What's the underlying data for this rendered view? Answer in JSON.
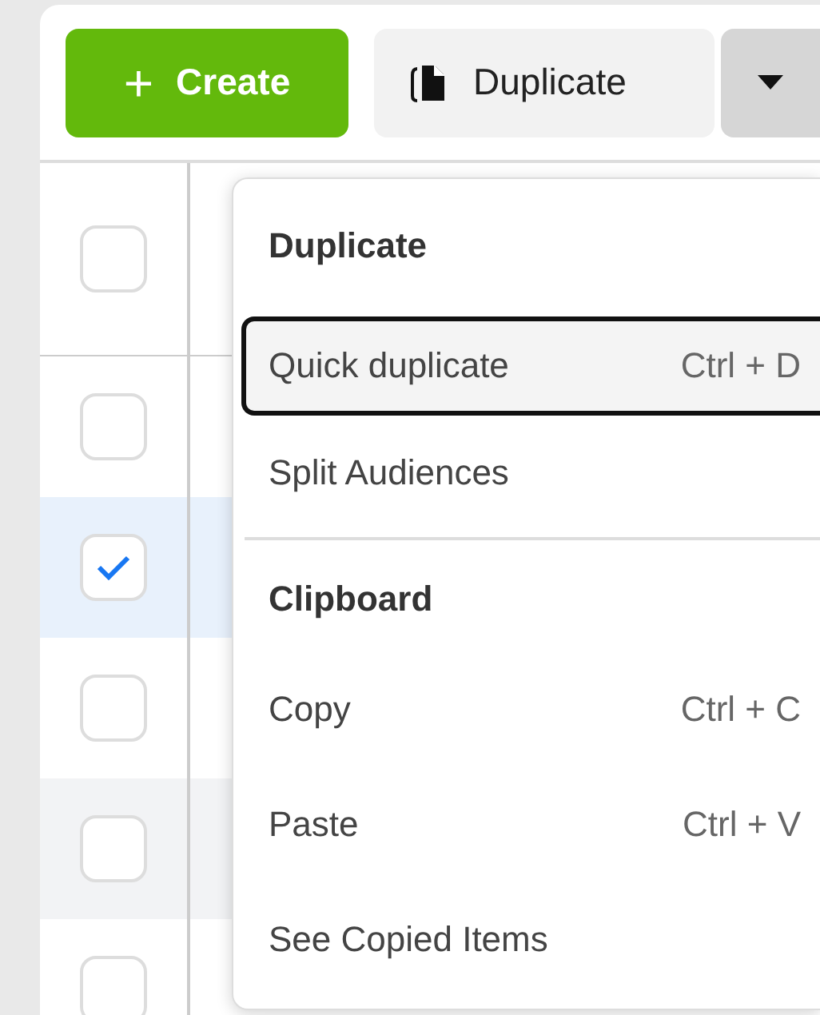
{
  "toolbar": {
    "create_button": {
      "icon": "+",
      "label": "Create"
    },
    "duplicate_button": {
      "label": "Duplicate"
    },
    "more_button": {
      "expanded": true
    }
  },
  "table": {
    "rows": [
      {
        "kind": "header",
        "checked": false
      },
      {
        "kind": "row",
        "checked": false,
        "selected": false,
        "hovered": false
      },
      {
        "kind": "row",
        "checked": true,
        "selected": true,
        "hovered": false
      },
      {
        "kind": "row",
        "checked": false,
        "selected": false,
        "hovered": false
      },
      {
        "kind": "row",
        "checked": false,
        "selected": false,
        "hovered": true
      },
      {
        "kind": "row",
        "checked": false,
        "selected": false,
        "hovered": false
      }
    ]
  },
  "menu": {
    "sections": [
      {
        "title": "Duplicate",
        "items": [
          {
            "label": "Quick duplicate",
            "shortcut": "Ctrl + D",
            "focused": true
          },
          {
            "label": "Split Audiences",
            "focused": false
          }
        ]
      },
      {
        "title": "Clipboard",
        "items": [
          {
            "label": "Copy",
            "shortcut": "Ctrl + C",
            "focused": false
          },
          {
            "label": "Paste",
            "shortcut": "Ctrl + V",
            "focused": false
          },
          {
            "label": "See Copied Items",
            "focused": false
          }
        ]
      }
    ]
  }
}
